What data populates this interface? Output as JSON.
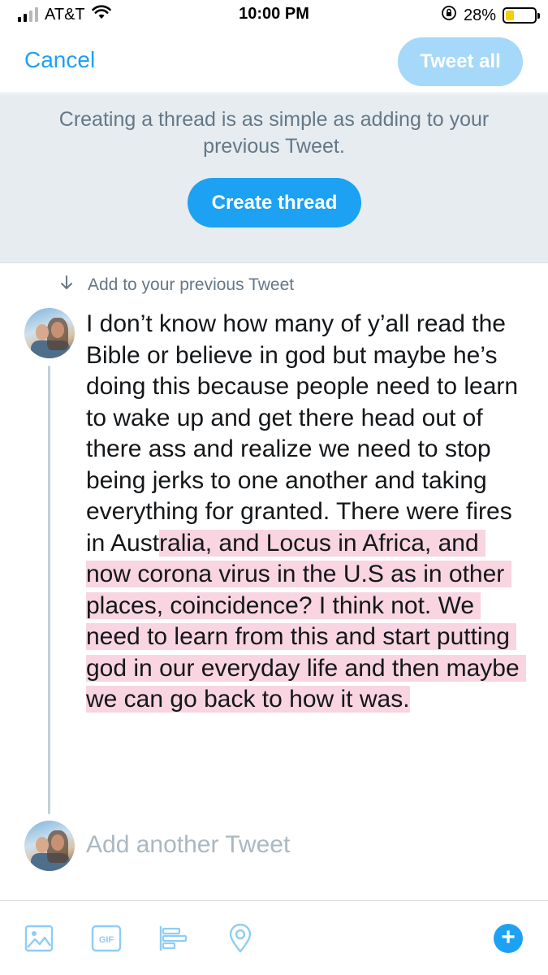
{
  "status_bar": {
    "carrier": "AT&T",
    "time": "10:00 PM",
    "battery_percent": "28%",
    "battery_level": 0.28,
    "signal_bars_active": 2,
    "signal_bars_total": 4
  },
  "nav": {
    "cancel_label": "Cancel",
    "tweet_all_label": "Tweet all"
  },
  "banner": {
    "text": "Creating a thread is as simple as adding to your previous Tweet.",
    "button_label": "Create thread"
  },
  "thread": {
    "add_previous_label": "Add to your previous Tweet",
    "tweet_text_plain": "I don’t know how many of y’all read the Bible or believe in god but maybe he’s doing this because people need to learn to wake up and get there head out of there ass and realize we need to stop being jerks to one another and taking everything for granted. There were fires in Aust",
    "tweet_text_highlighted": "ralia, and Locus in Africa, and now corona virus in the U.S as in other places, coincidence? I think not. We need to learn from this and start putting god in our everyday life and then maybe we can go back to how it was.",
    "add_another_placeholder": "Add another Tweet"
  },
  "toolbar": {
    "gif_label": "GIF",
    "plus_label": "+",
    "icons": [
      "image-icon",
      "gif-icon",
      "poll-icon",
      "location-icon",
      "add-tweet-icon"
    ]
  },
  "colors": {
    "accent": "#1da1f2",
    "accent_disabled": "#a5d8f9",
    "banner_bg": "#e6ecf0",
    "secondary_text": "#657786",
    "highlight": "#f8d5e1",
    "placeholder": "#aab8c2"
  }
}
